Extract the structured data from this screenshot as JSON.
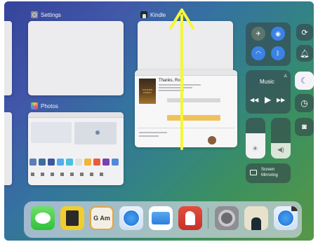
{
  "apps": {
    "settings": {
      "name": "Settings"
    },
    "kindle": {
      "name": "Kindle"
    },
    "photos": {
      "name": "Photos"
    }
  },
  "kindle_card": {
    "heading": "Thanks, Rob!",
    "book_cover": "THE BARK FOREST"
  },
  "control_center": {
    "music_label": "Music",
    "screen_mirroring_label": "Screen\nMirroring"
  },
  "dock": {
    "icons": [
      "messages-icon",
      "scrivener-icon",
      "word-processor-icon",
      "safari-icon",
      "files-icon",
      "bear-icon",
      "settings-icon",
      "kindle-icon",
      "safari-icon"
    ],
    "word_icon_text": "G Am"
  },
  "gesture": {
    "direction": "swipe-up",
    "color": "#f6f63a"
  }
}
